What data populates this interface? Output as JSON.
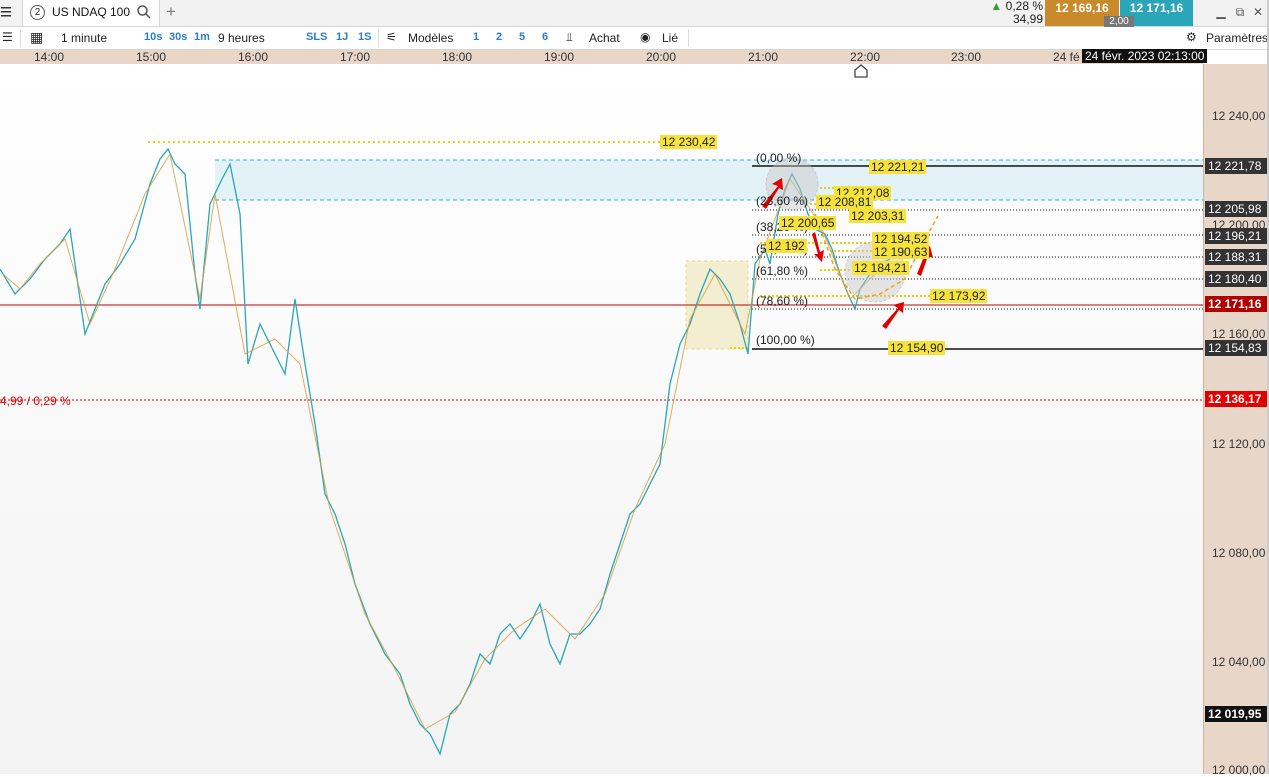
{
  "topbar": {
    "tab_number": "2",
    "symbol": "US NDAQ 100",
    "change_pct": "▲ 0,28 %",
    "change_abs": "34,99",
    "bid": "12 169,16",
    "ask": "12 171,16",
    "spread": "2,00"
  },
  "toolbar": {
    "interval": "1 minute",
    "btn_10s": "10s",
    "btn_30s": "30s",
    "btn_1m": "1m",
    "range": "9 heures",
    "btn_sls": "SLS",
    "btn_1j": "1J",
    "btn_1s": "1S",
    "models": "Modèles",
    "p1": "1",
    "p2": "2",
    "p5": "5",
    "p6": "6",
    "buy": "Achat",
    "linked": "Lié",
    "settings": "Paramètres"
  },
  "time_axis": [
    "14:00",
    "15:00",
    "16:00",
    "17:00",
    "18:00",
    "19:00",
    "20:00",
    "21:00",
    "22:00",
    "23:00",
    "24 fé"
  ],
  "date_badge": "24 févr. 2023 02:13:00",
  "price_axis": {
    "ticks": [
      "12 240,00",
      "12 200,00",
      "12 160,00",
      "12 120,00",
      "12 080,00",
      "12 040,00",
      "12 000,00"
    ],
    "current": "12 171,16",
    "low": "12 019,95",
    "ref": "12 136,17",
    "levels": [
      "12 221,78",
      "12 205,98",
      "12 196,21",
      "12 188,31",
      "12 180,40",
      "12 154,83"
    ]
  },
  "annotations": {
    "high_label": "12 230,42",
    "ref_text": "4,99 / 0,29 %",
    "fib_0": "(0,00 %)",
    "fib_236": "(23,60 %)",
    "fib_382": "(38,20 %)",
    "fib_50": "(50,00 %)",
    "fib_618": "(61,80 %)",
    "fib_786": "(78,60 %)",
    "fib_100": "(100,00 %)",
    "lbl_221": "12 221,21",
    "lbl_212": "12 212,08",
    "lbl_208": "12 208,81",
    "lbl_203": "12 203,31",
    "lbl_200": "12 200,65",
    "lbl_194": "12 194,52",
    "lbl_192": "12 192",
    "lbl_190": "12 190,63",
    "lbl_184": "12 184,21",
    "lbl_173": "12 173,92",
    "lbl_154": "12 154,90"
  },
  "colors": {
    "bid_bg": "#c98a2c",
    "ask_bg": "#2aa6b8",
    "up_candle": "#2aa6b8",
    "down_candle": "#d49a3a",
    "current_price": "#b00000",
    "ref_price": "#e00000",
    "axis_bg": "#e8d7c9",
    "highlight_label": "#f5e23a"
  }
}
